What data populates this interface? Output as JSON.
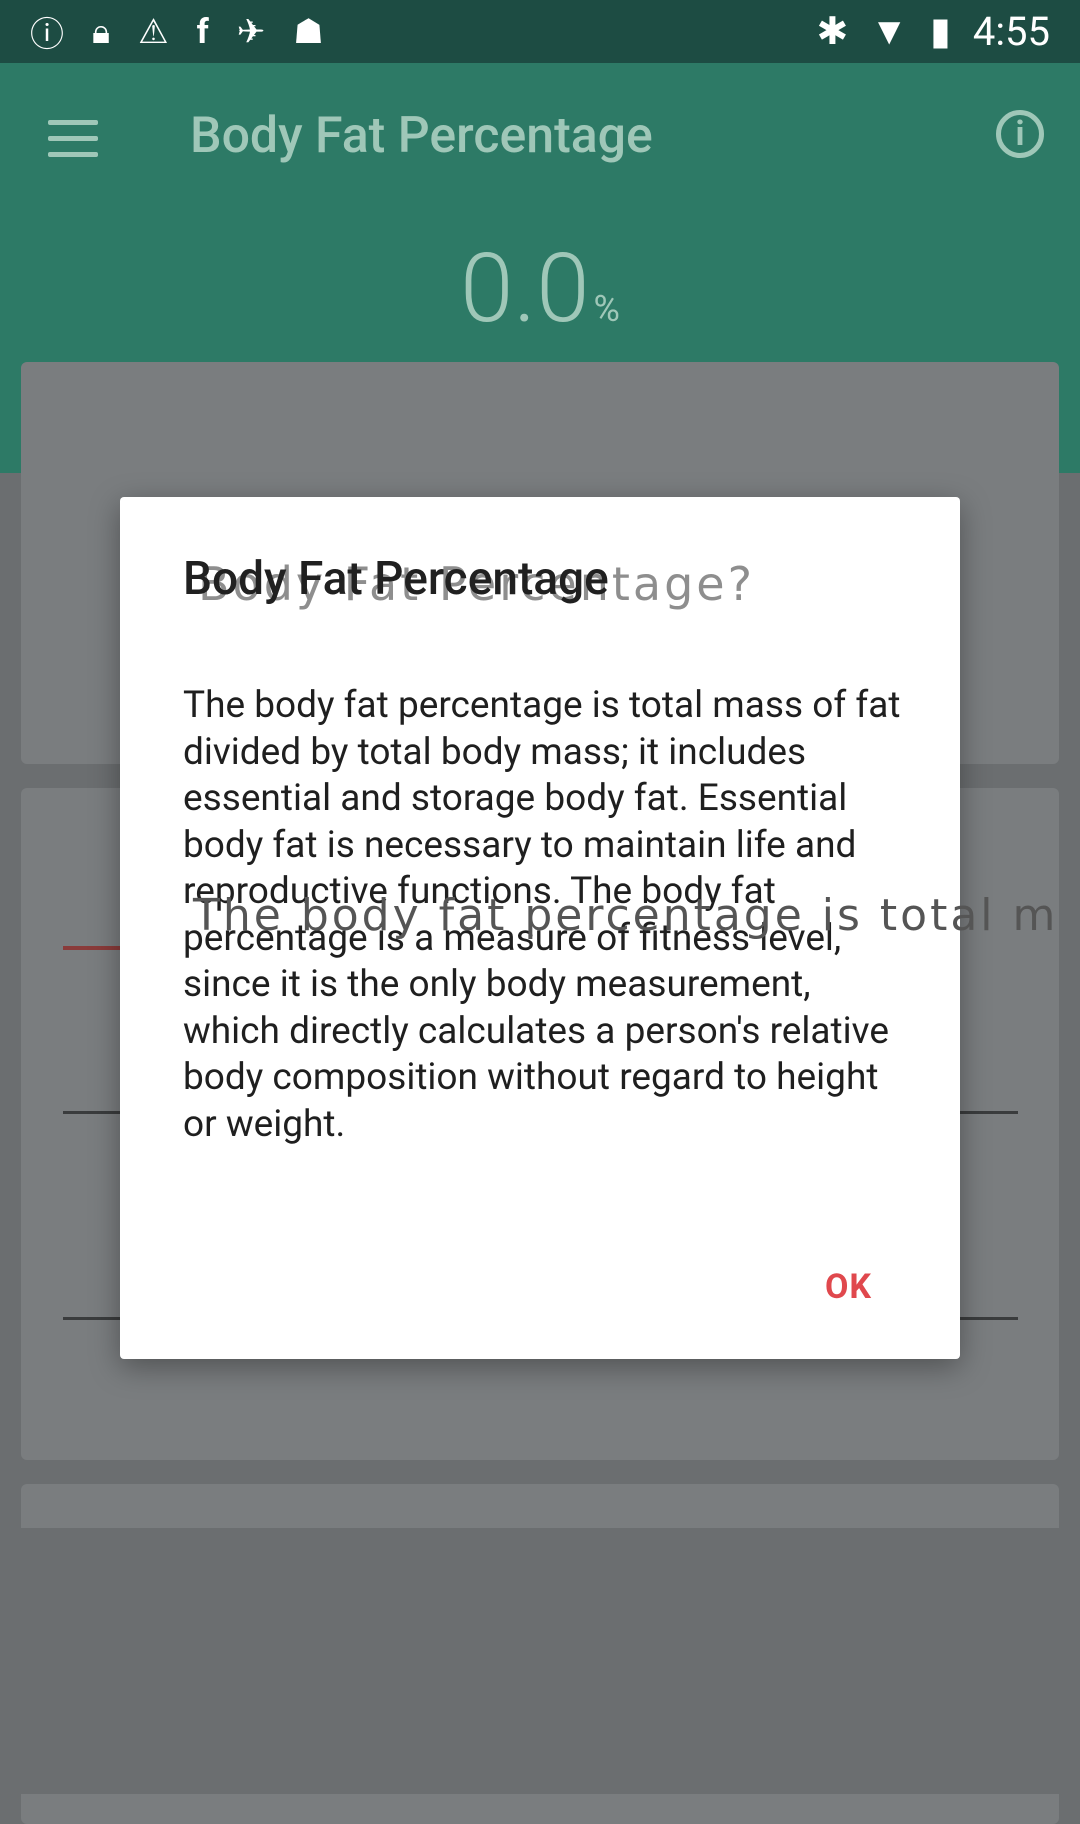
{
  "status_bar": {
    "time": "4:55",
    "icons_left": [
      "info-circle-icon",
      "lock-icon",
      "warning-icon",
      "facebook-icon",
      "satellite-icon",
      "android-icon"
    ],
    "icons_right": [
      "bluetooth-icon",
      "wifi-icon",
      "battery-charging-icon"
    ]
  },
  "app_bar": {
    "title": "Body Fat Percentage",
    "result_value": "0.0",
    "result_unit": "%"
  },
  "dialog": {
    "title": "Body Fat Percentage",
    "title_ghost": "Body Fat Percentage?",
    "body": "The body fat percentage is total mass of fat divided by total body mass; it includes essential and storage body fat. Essential body fat is necessary to maintain life and reproductive functions. The body fat percentage is a measure of fitness level, since it is the only body measurement, which directly calculates a person's relative body composition without regard to height or weight.",
    "body_ghost": "The body fat percentage is total m",
    "ok_label": "OK"
  },
  "colors": {
    "status_bar": "#1d4c43",
    "app_bar": "#2d7a66",
    "accent": "#e0484d"
  }
}
